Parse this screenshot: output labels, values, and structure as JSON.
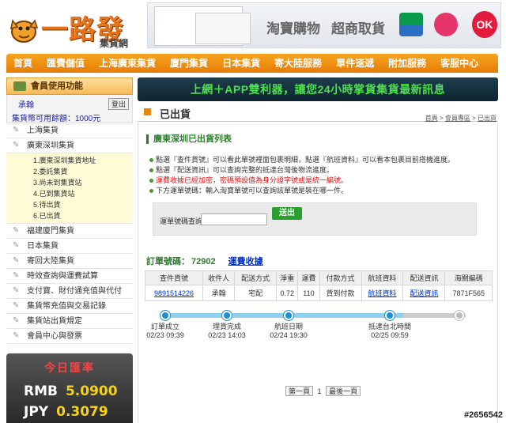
{
  "header": {
    "logo_text": "一路發",
    "logo_sub": "集貨網",
    "banner_text1": "淘寶購物",
    "banner_text2": "超商取貨",
    "banner_logo_label": "OK"
  },
  "nav": [
    {
      "label": "首頁"
    },
    {
      "label": "匯費儲值"
    },
    {
      "label": "上海廣東集貨"
    },
    {
      "label": "廈門集貨"
    },
    {
      "label": "日本集貨"
    },
    {
      "label": "寄大陸服務"
    },
    {
      "label": "單件速遞"
    },
    {
      "label": "附加服務"
    },
    {
      "label": "客服中心"
    }
  ],
  "sidebar": {
    "title": "會員使用功能",
    "account_name": "承翰",
    "balance": "集貨幣可用餘額：1000元",
    "logout": "登出",
    "items": [
      {
        "label": "上海集貨"
      },
      {
        "label": "廣東深圳集貨"
      }
    ],
    "sub_items": [
      {
        "label": "1.廣東深圳集貨地址"
      },
      {
        "label": "2.委託集貨"
      },
      {
        "label": "3.尚未到集貨站"
      },
      {
        "label": "4.已到集貨站"
      },
      {
        "label": "5.待出貨"
      },
      {
        "label": "6.已出貨"
      }
    ],
    "items_after": [
      {
        "label": "福建廈門集貨"
      },
      {
        "label": "日本集貨"
      },
      {
        "label": "寄回大陸集貨"
      },
      {
        "label": "時效查詢與運費試算"
      },
      {
        "label": "支付寶、財付通充值與代付"
      },
      {
        "label": "集貨幣充值與交易記錄"
      },
      {
        "label": "集貨站出貨規定"
      },
      {
        "label": "會員中心與發票"
      }
    ]
  },
  "rates": {
    "title": "今日匯率",
    "rmb_label": "RMB",
    "rmb_value": "5.0900",
    "jpy_label": "JPY",
    "jpy_value": "0.3079"
  },
  "main": {
    "promo": "上網＋APP雙利器，讓您24小時掌貨集貨最新訊息",
    "page_title": "已出貨",
    "crumb_1": "首頁",
    "crumb_2": "會員專區",
    "crumb_3": "已出貨",
    "section_title": "廣東深圳已出貨列表",
    "notes": [
      "點選『查件貨號』可以看此單號裡面包裹明細，點選『航班資料』可以看本包裹目前搭機進度。",
      "點選『配送資訊』可以查詢完整的抵達台灣後物流進度。",
      "運費收據已經加密，密碼預設值為身分證字號或是統一編號。",
      "下方運單號碼：輸入淘寶單號可以查詢該單號是裝在哪一件。"
    ],
    "query_label": "運單號碼查詢",
    "query_button": "送出",
    "order_label": "訂單號碼：",
    "order_number": "72902",
    "fee_receipt": "運費收據"
  },
  "table": {
    "headers": [
      "查件貨號",
      "收件人",
      "配送方式",
      "淨重",
      "運費",
      "付款方式",
      "航班資料",
      "配送資訊",
      "海關編碼"
    ],
    "rows": [
      [
        "9891514226",
        "承翰",
        "宅配",
        "0.72",
        "110",
        "貨到付款",
        "航班資料",
        "配送資訊",
        "7871F565"
      ]
    ]
  },
  "timeline": {
    "steps": [
      {
        "label": "訂單成立",
        "time": "02/23 09:39",
        "done": true
      },
      {
        "label": "理貨完成",
        "time": "02/23 14:03",
        "done": true
      },
      {
        "label": "航班日期",
        "time": "02/24 19:30",
        "done": true
      },
      {
        "label": "抵達台北時間",
        "time": "02/25 09:59",
        "done": true
      },
      {
        "label": "",
        "time": "",
        "done": false
      }
    ]
  },
  "pager": {
    "prev": "第一頁",
    "current": "1",
    "last": "最後一頁"
  },
  "watermark": "#2656542"
}
